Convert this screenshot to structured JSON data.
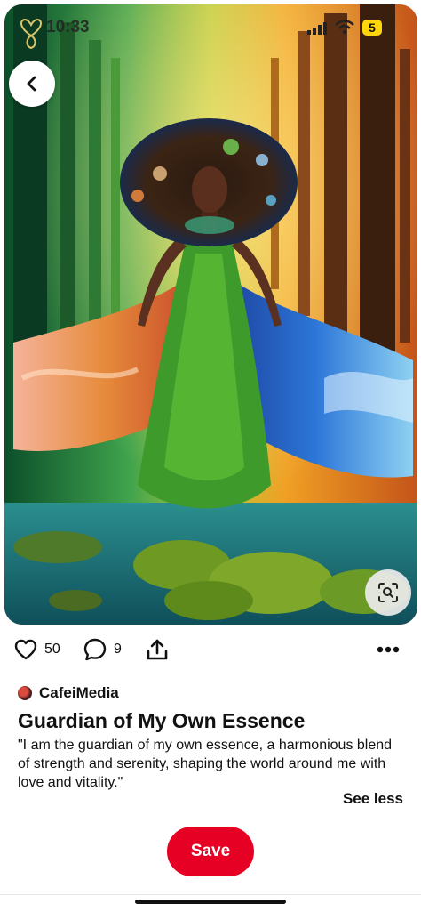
{
  "status_bar": {
    "time": "10:33",
    "battery": "5"
  },
  "pin": {
    "likes": "50",
    "comments": "9",
    "author": "CafeiMedia",
    "title": "Guardian of My Own Essence",
    "description": "\"I am the guardian of my own essence, a harmonious blend of strength and serenity, shaping the world around me with love and vitality.\"",
    "see_less": "See less",
    "save_label": "Save"
  },
  "icons": {
    "back": "chevron-left-icon",
    "visual_search": "lens-search-icon",
    "like": "heart-icon",
    "comment": "comment-bubble-icon",
    "share": "share-icon",
    "more": "more-dots-icon"
  },
  "colors": {
    "save": "#e60023",
    "battery_badge": "#ffd60a"
  }
}
